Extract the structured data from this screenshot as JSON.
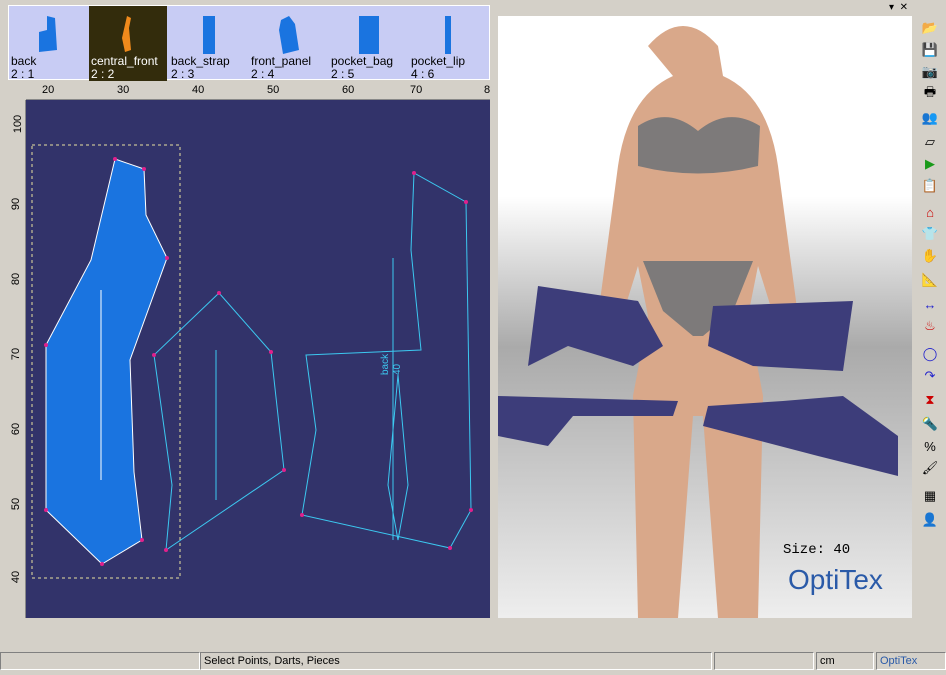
{
  "pieces": [
    {
      "name": "back",
      "count": "2 : 1",
      "selected": false
    },
    {
      "name": "central_front",
      "count": "2 : 2",
      "selected": true
    },
    {
      "name": "back_strap",
      "count": "2 : 3",
      "selected": false
    },
    {
      "name": "front_panel",
      "count": "2 : 4",
      "selected": false
    },
    {
      "name": "pocket_bag",
      "count": "2 : 5",
      "selected": false
    },
    {
      "name": "pocket_lip",
      "count": "4 : 6",
      "selected": false
    }
  ],
  "ruler_top": [
    "20",
    "30",
    "40",
    "50",
    "60",
    "70",
    "8"
  ],
  "ruler_left": [
    "100",
    "90",
    "80",
    "70",
    "60",
    "50",
    "40"
  ],
  "canvas_labels": {
    "back": "back",
    "size": "40"
  },
  "view3d": {
    "size_label": "Size: 40",
    "logo": "OptiTex"
  },
  "toolbar": [
    "open-model",
    "save-model",
    "camera",
    "print",
    "avatars",
    "eraser",
    "play",
    "properties",
    "sewing",
    "garment",
    "hand",
    "measure",
    "stretch",
    "fabric",
    "zoom",
    "rotate",
    "hourglass",
    "light",
    "percent",
    "paint",
    "texture",
    "avatar-panel"
  ],
  "status": {
    "message": "Select Points, Darts, Pieces",
    "units": "cm",
    "logo": "OptiTex"
  },
  "colors": {
    "canvas": "#32336a",
    "piece": "#1a74e0",
    "selected": "#f08a1c",
    "line": "#3cc8f0",
    "point": "#e0208c"
  }
}
